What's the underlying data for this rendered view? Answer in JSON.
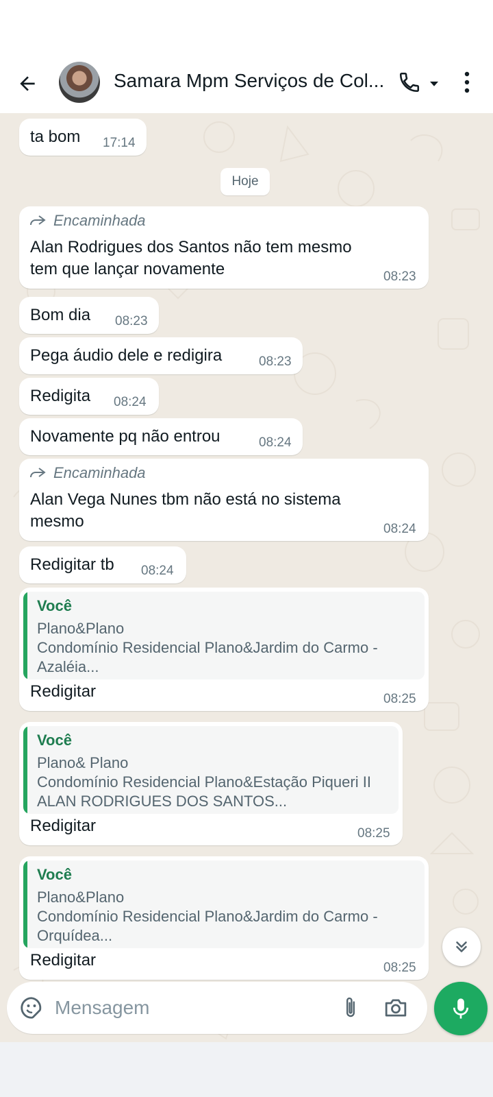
{
  "header": {
    "contact_name": "Samara Mpm Serviços de Col...",
    "icons": {
      "back": "arrow-left-icon",
      "call": "phone-icon",
      "caret": "caret-down-icon",
      "menu": "more-vertical-icon"
    }
  },
  "date_separator": "Hoje",
  "forwarded_label": "Encaminhada",
  "messages": [
    {
      "text": "ta bom",
      "time": "17:14"
    },
    {
      "text_lines": [
        "Alan Rodrigues dos Santos não tem mesmo",
        "tem que lançar novamente"
      ],
      "time": "08:23",
      "forwarded": true
    },
    {
      "text": "Bom dia",
      "time": "08:23"
    },
    {
      "text": "Pega áudio dele e redigira",
      "time": "08:23"
    },
    {
      "text": "Redigita",
      "time": "08:24"
    },
    {
      "text": "Novamente pq não entrou",
      "time": "08:24"
    },
    {
      "text_lines": [
        "Alan Vega Nunes tbm não está no sistema",
        "mesmo"
      ],
      "time": "08:24",
      "forwarded": true
    },
    {
      "text": "Redigitar tb",
      "time": "08:24"
    },
    {
      "quote": {
        "author": "Você",
        "lines": [
          "Plano&Plano",
          "Condomínio Residencial Plano&Jardim do Carmo -",
          "Azaléia..."
        ]
      },
      "text": "Redigitar",
      "time": "08:25"
    },
    {
      "quote": {
        "author": "Você",
        "lines": [
          "Plano& Plano",
          "Condomínio Residencial Plano&Estação Piqueri II",
          "ALAN RODRIGUES DOS SANTOS..."
        ]
      },
      "text": "Redigitar",
      "time": "08:25"
    },
    {
      "quote": {
        "author": "Você",
        "lines": [
          "Plano&Plano",
          "Condomínio Residencial Plano&Jardim do Carmo -",
          "Orquídea..."
        ]
      },
      "text": "Redigitar",
      "time": "08:25"
    }
  ],
  "composer": {
    "placeholder": "Mensagem",
    "icons": {
      "emoji": "sticker-emoji-icon",
      "attach": "paperclip-icon",
      "camera": "camera-icon",
      "mic": "microphone-icon"
    }
  },
  "colors": {
    "accent": "#1daa61",
    "chat_bg": "#efeae2",
    "quote_bar": "#25a55f",
    "quote_author": "#1f7d50"
  }
}
